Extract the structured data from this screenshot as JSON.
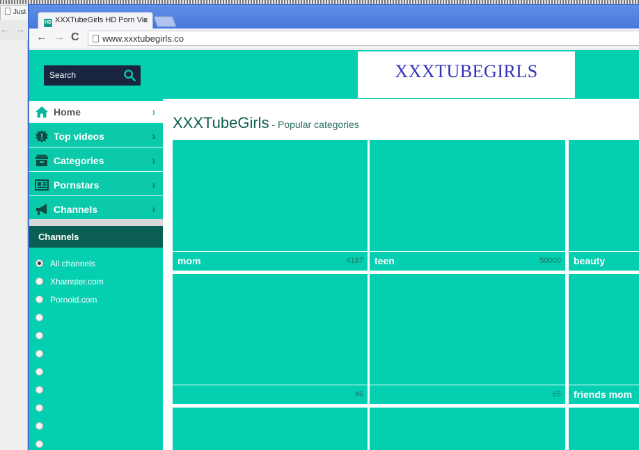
{
  "background_window": {
    "tab_title": "Just",
    "back_glyph": "←",
    "forward_glyph": "→"
  },
  "browser": {
    "tab_title": "XXXTubeGirls HD Porn Vic",
    "favicon_text": "HD",
    "close_glyph": "×",
    "back_glyph": "←",
    "forward_glyph": "→",
    "reload_glyph": "C",
    "url": "www.xxxtubegirls.co"
  },
  "header": {
    "search_label": "Search",
    "logo_text": "XXXTUBEGIRLS"
  },
  "colors": {
    "teal": "#04cfb0",
    "dark_navy": "#1a2540",
    "channels_header": "#0b5e52",
    "logo_blue": "#3030b8"
  },
  "sidebar": {
    "menu": [
      {
        "label": "Home",
        "icon": "home-icon",
        "active": true
      },
      {
        "label": "Top videos",
        "icon": "badge-icon",
        "active": false
      },
      {
        "label": "Categories",
        "icon": "box-icon",
        "active": false
      },
      {
        "label": "Pornstars",
        "icon": "id-card-icon",
        "active": false
      },
      {
        "label": "Channels",
        "icon": "megaphone-icon",
        "active": false
      }
    ],
    "chevron": "›",
    "channels_header": "Channels",
    "channels": [
      {
        "label": "All channels",
        "selected": true
      },
      {
        "label": "Xhamster.com",
        "selected": false
      },
      {
        "label": "Pornoid.com",
        "selected": false
      },
      {
        "label": "",
        "selected": false
      },
      {
        "label": "",
        "selected": false
      },
      {
        "label": "",
        "selected": false
      },
      {
        "label": "",
        "selected": false
      },
      {
        "label": "",
        "selected": false
      },
      {
        "label": "",
        "selected": false
      },
      {
        "label": "",
        "selected": false
      },
      {
        "label": "",
        "selected": false
      }
    ]
  },
  "main": {
    "site_name": "XXXTubeGirls",
    "subtitle": " - Popular categories",
    "categories": [
      {
        "name": "mom",
        "count": "4187"
      },
      {
        "name": "teen",
        "count": "50000"
      },
      {
        "name": "beauty",
        "count": ""
      },
      {
        "name": "",
        "count": "46"
      },
      {
        "name": "",
        "count": "65"
      },
      {
        "name": "friends mom",
        "count": ""
      },
      {
        "name": "",
        "count": ""
      },
      {
        "name": "",
        "count": ""
      },
      {
        "name": "",
        "count": ""
      }
    ]
  }
}
